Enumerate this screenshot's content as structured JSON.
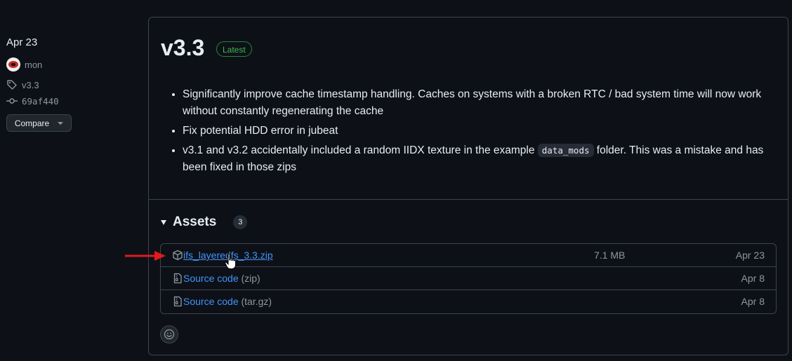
{
  "sidebar": {
    "date": "Apr 23",
    "author": "mon",
    "tag": "v3.3",
    "commit": "69af440",
    "compare_label": "Compare"
  },
  "release": {
    "title": "v3.3",
    "badge": "Latest",
    "notes": [
      "Significantly improve cache timestamp handling. Caches on systems with a broken RTC / bad system time will now work without constantly regenerating the cache",
      "Fix potential HDD error in jubeat"
    ],
    "note3_before": "v3.1 and v3.2 accidentally included a random IIDX texture in the example ",
    "note3_code": "data_mods",
    "note3_after": " folder. This was a mistake and has been fixed in those zips"
  },
  "assets": {
    "title": "Assets",
    "count": "3",
    "items": [
      {
        "name": "ifs_layeredfs_3.3.zip",
        "ext": "",
        "size": "7.1 MB",
        "date": "Apr 23",
        "icon": "package-icon"
      },
      {
        "name": "Source code",
        "ext": "(zip)",
        "size": "",
        "date": "Apr 8",
        "icon": "file-zip-icon"
      },
      {
        "name": "Source code",
        "ext": "(tar.gz)",
        "size": "",
        "date": "Apr 8",
        "icon": "file-zip-icon"
      }
    ]
  },
  "colors": {
    "background": "#0d1117",
    "border": "#3d444d",
    "link": "#4493f8",
    "latest_green": "#3fb950",
    "annotation_arrow": "#e01b1b"
  }
}
